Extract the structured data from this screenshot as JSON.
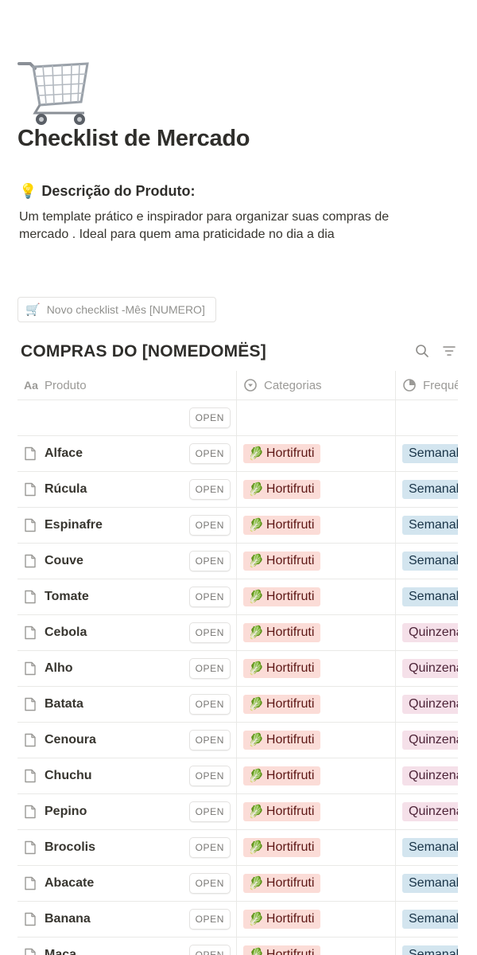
{
  "page": {
    "icon": "shopping-cart-icon",
    "title": "Checklist de Mercado"
  },
  "description": {
    "icon": "lightbulb-icon",
    "heading": "Descrição do Produto:",
    "text": "Um template prático e inspirador para organizar suas compras de mercado . Ideal para quem ama praticidade no dia a dia"
  },
  "template_button": {
    "icon": "shopping-cart-icon",
    "label": "Novo checklist -Mês [NUMERO]"
  },
  "database": {
    "title": "COMPRAS DO [NOMEDOMËS]",
    "tools": [
      "search-icon",
      "filter-icon"
    ],
    "columns": [
      {
        "label": "Produto",
        "icon": "title-property-icon"
      },
      {
        "label": "Categorias",
        "icon": "select-property-icon"
      },
      {
        "label": "Frequência",
        "icon": "status-property-icon"
      }
    ],
    "open_label": "OPEN",
    "rows": [
      {
        "name": "",
        "category": "",
        "frequency": ""
      },
      {
        "name": "Alface",
        "category": "Hortifruti",
        "frequency": "Semanal"
      },
      {
        "name": "Rúcula",
        "category": "Hortifruti",
        "frequency": "Semanal"
      },
      {
        "name": "Espinafre",
        "category": "Hortifruti",
        "frequency": "Semanal"
      },
      {
        "name": "Couve",
        "category": "Hortifruti",
        "frequency": "Semanal"
      },
      {
        "name": "Tomate",
        "category": "Hortifruti",
        "frequency": "Semanal"
      },
      {
        "name": "Cebola",
        "category": "Hortifruti",
        "frequency": "Quinzenal"
      },
      {
        "name": "Alho",
        "category": "Hortifruti",
        "frequency": "Quinzenal"
      },
      {
        "name": "Batata",
        "category": "Hortifruti",
        "frequency": "Quinzenal"
      },
      {
        "name": "Cenoura",
        "category": "Hortifruti",
        "frequency": "Quinzenal"
      },
      {
        "name": "Chuchu",
        "category": "Hortifruti",
        "frequency": "Quinzenal"
      },
      {
        "name": "Pepino",
        "category": "Hortifruti",
        "frequency": "Quinzenal"
      },
      {
        "name": "Brocolis",
        "category": "Hortifruti",
        "frequency": "Semanal"
      },
      {
        "name": "Abacate",
        "category": "Hortifruti",
        "frequency": "Semanal"
      },
      {
        "name": "Banana",
        "category": "Hortifruti",
        "frequency": "Semanal"
      },
      {
        "name": "Maça",
        "category": "Hortifruti",
        "frequency": "Semanal"
      }
    ]
  },
  "colors": {
    "category_bg": "#fbdcd7",
    "freq_semanal_bg": "#d3e5ef",
    "freq_quinzenal_bg": "#f5e0e9"
  }
}
